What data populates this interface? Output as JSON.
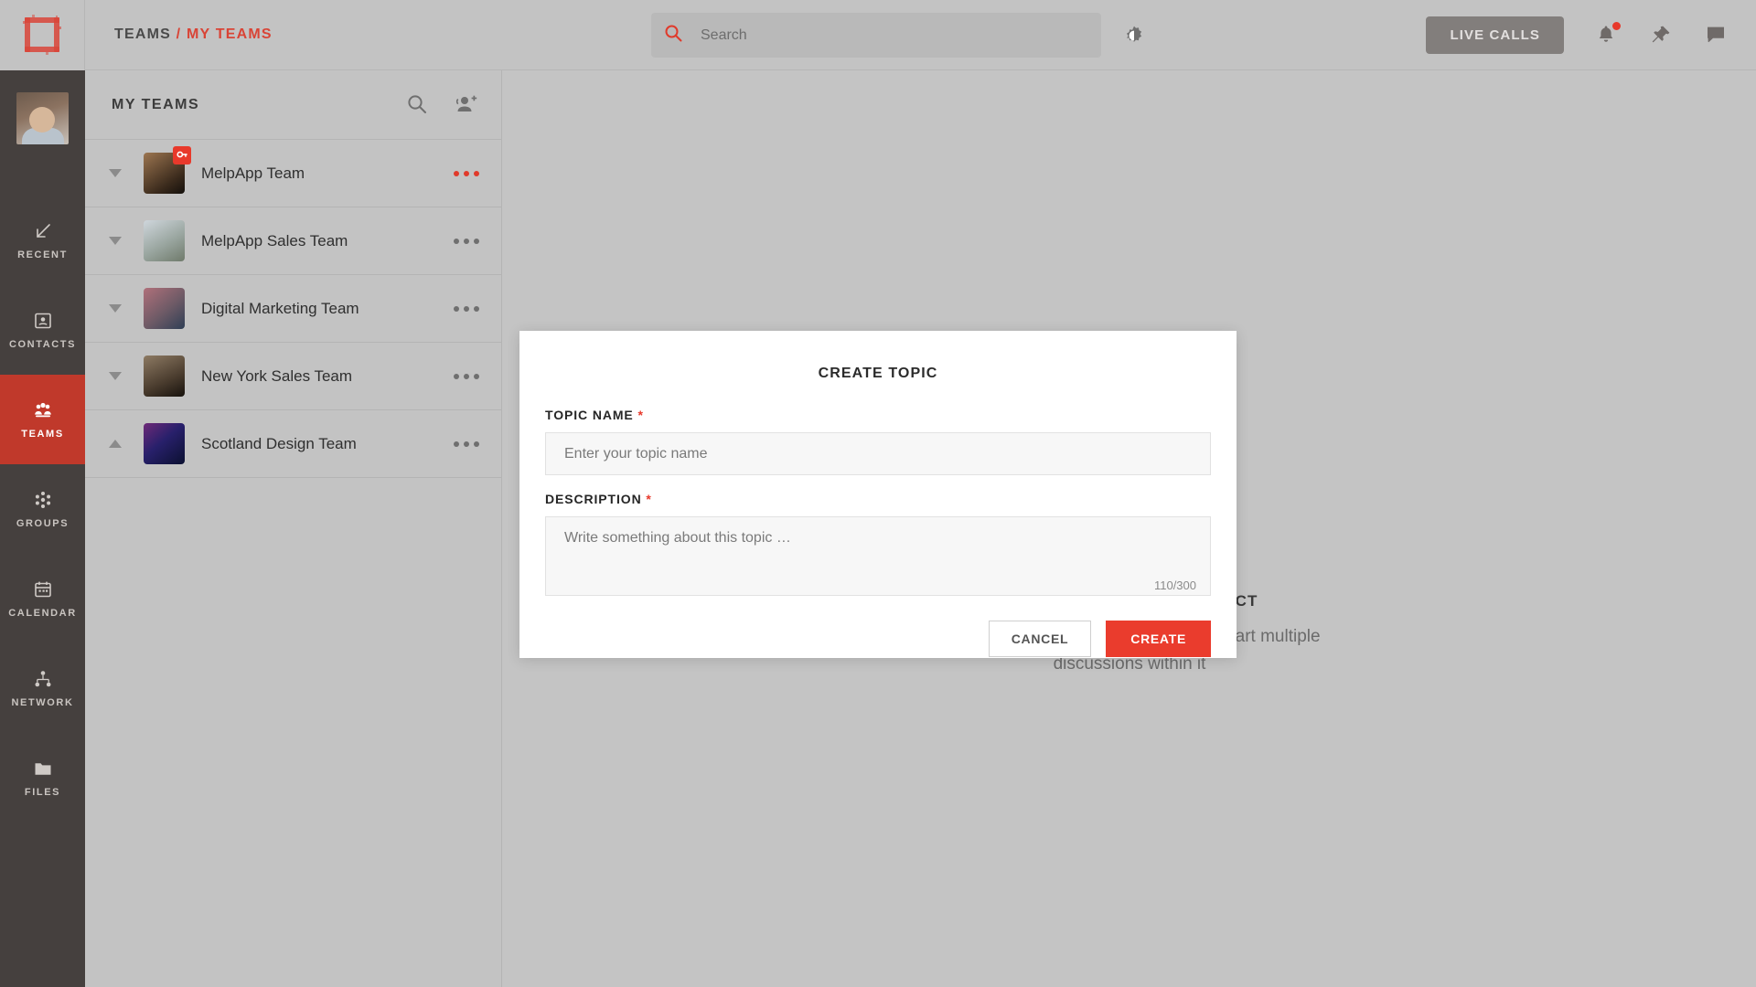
{
  "colors": {
    "accent": "#e8392b",
    "accent_button": "#ea3c2d",
    "rail_bg": "#45403e",
    "rail_active": "#c0392b",
    "panel_bg": "#c3c3c3",
    "app_bg": "#c4c4c4"
  },
  "topbar": {
    "logo_name": "melpapp-logo",
    "breadcrumb": {
      "root": "TEAMS",
      "separator": "/",
      "current": "MY TEAMS"
    },
    "search": {
      "placeholder": "Search",
      "value": "",
      "icon": "search-icon"
    },
    "theme_toggle_icon": "brightness-icon",
    "live_calls_label": "LIVE CALLS",
    "icons": [
      {
        "name": "notification-bell-icon",
        "has_badge": true
      },
      {
        "name": "pin-icon",
        "has_badge": false
      },
      {
        "name": "chat-bubble-icon",
        "has_badge": false
      }
    ]
  },
  "rail": {
    "avatar_name": "user-avatar",
    "items": [
      {
        "label": "RECENT",
        "icon": "arrow-down-left-icon",
        "active": false
      },
      {
        "label": "CONTACTS",
        "icon": "contact-card-icon",
        "active": false
      },
      {
        "label": "TEAMS",
        "icon": "teams-people-icon",
        "active": true
      },
      {
        "label": "GROUPS",
        "icon": "groups-circle-icon",
        "active": false
      },
      {
        "label": "CALENDAR",
        "icon": "calendar-icon",
        "active": false
      },
      {
        "label": "NETWORK",
        "icon": "network-nodes-icon",
        "active": false
      },
      {
        "label": "FILES",
        "icon": "folder-icon",
        "active": false
      }
    ]
  },
  "panel": {
    "title": "MY TEAMS",
    "search_icon": "search-icon",
    "add_member_icon": "add-person-icon",
    "teams": [
      {
        "name": "MelpApp Team",
        "expanded": false,
        "locked": true,
        "menu_highlighted": true,
        "thumb_from": "#7a5a3e",
        "thumb_to": "#2d2119"
      },
      {
        "name": "MelpApp Sales Team",
        "expanded": false,
        "locked": false,
        "menu_highlighted": false,
        "thumb_from": "#b9c3cf",
        "thumb_to": "#7e8a7a"
      },
      {
        "name": "Digital Marketing Team",
        "expanded": false,
        "locked": false,
        "menu_highlighted": false,
        "thumb_from": "#8f5f6a",
        "thumb_to": "#3d4a5c"
      },
      {
        "name": "New York Sales Team",
        "expanded": false,
        "locked": false,
        "menu_highlighted": false,
        "thumb_from": "#6e5a48",
        "thumb_to": "#241c16"
      },
      {
        "name": "Scotland Design Team",
        "expanded": true,
        "locked": false,
        "menu_highlighted": false,
        "thumb_from": "#3a1f4e",
        "thumb_to": "#0d1430"
      }
    ]
  },
  "main": {
    "empty_title": "SELECT A TEAM TO CONNECT",
    "empty_subtitle": "Select teams from the left panel and start multiple discussions within it",
    "illustration_name": "team-connect-illustration"
  },
  "modal": {
    "title": "CREATE TOPIC",
    "topic_name": {
      "label": "TOPIC NAME",
      "required_mark": "*",
      "placeholder": "Enter your topic name",
      "value": ""
    },
    "description": {
      "label": "DESCRIPTION",
      "required_mark": "*",
      "placeholder": "Write something about this topic …",
      "value": "",
      "counter": "110/300"
    },
    "cancel_label": "CANCEL",
    "create_label": "CREATE"
  }
}
